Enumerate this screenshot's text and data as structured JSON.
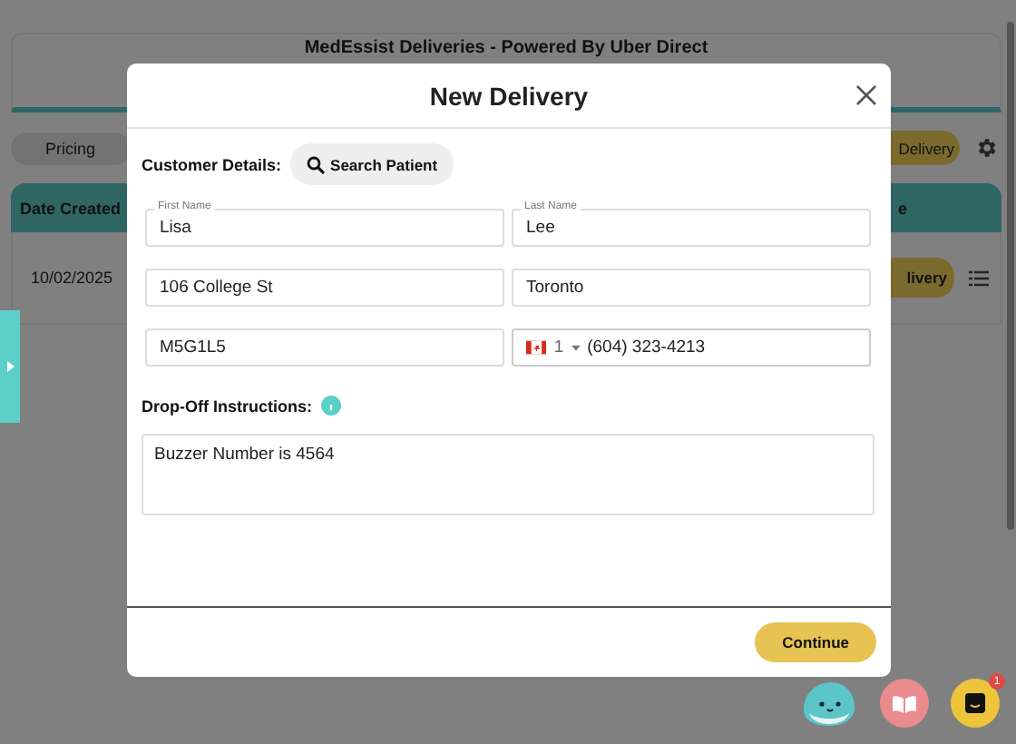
{
  "background": {
    "title": "MedEssist Deliveries - Powered By Uber Direct",
    "pricing_button": "Pricing",
    "new_delivery_button": "Delivery",
    "table": {
      "columns": [
        "Date Created",
        "e"
      ],
      "rows": [
        {
          "date_created": "10/02/2025",
          "action_button": "livery"
        }
      ]
    }
  },
  "modal": {
    "title": "New Delivery",
    "customer_details_label": "Customer Details:",
    "search_button": "Search Patient",
    "fields": [
      {
        "kind": "text",
        "label": "First Name",
        "value": "Lisa"
      },
      {
        "kind": "text",
        "label": "Last Name",
        "value": "Lee"
      },
      {
        "kind": "text",
        "value": "106 College St"
      },
      {
        "kind": "text",
        "value": "Toronto"
      },
      {
        "kind": "text",
        "value": "M5G1L5"
      },
      {
        "kind": "phone",
        "country_code": "1",
        "value": "(604) 323-4213"
      }
    ],
    "instructions_label": "Drop-Off Instructions:",
    "instructions_value": "Buzzer Number is 4564",
    "continue_button": "Continue"
  },
  "chat_badge": "1"
}
